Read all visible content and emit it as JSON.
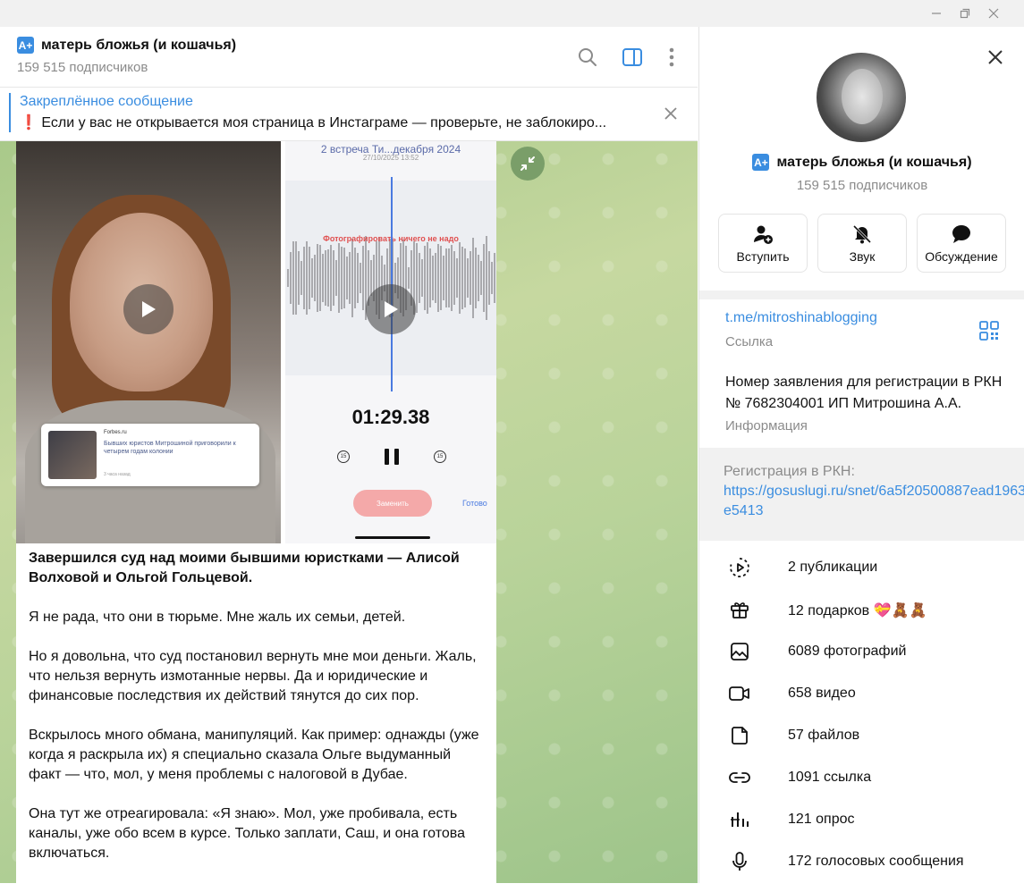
{
  "window": {
    "controls": [
      "minimize-icon",
      "restore-icon",
      "close-icon"
    ]
  },
  "header": {
    "badge": "A+",
    "title": "матерь бложья (и кошачья)",
    "subtitle": "159 515 подписчиков",
    "icons": [
      "search-icon",
      "sidebar-toggle-icon",
      "more-vertical-icon"
    ]
  },
  "pinned": {
    "title": "Закреплённое сообщение",
    "text": "❗️ Если у вас не открывается моя страница в Инстаграме — проверьте, не заблокиро..."
  },
  "message": {
    "media": {
      "left": {
        "news_source": "Forbes.ru",
        "news_headline": "Бывших юристов Митрошиной приговорили к четырем годам колонии",
        "news_time": "3 часа назад"
      },
      "right": {
        "title": "2 встреча Ти...декабря 2024",
        "date": "27/10/2025 13:52",
        "red_caption": "Фотографировать ничего не надо",
        "timer": "01:29.38",
        "skip_back": "15",
        "skip_fwd": "15",
        "pill_button": "Заменить",
        "ready": "Готово"
      }
    },
    "paragraphs": [
      "Завершился суд над моими бывшими юристками — Алисой Волховой и Ольгой Гольцевой.",
      "Я не рада, что они в тюрьме. Мне жаль их семьи, детей.",
      "Но я довольна, что суд постановил вернуть мне мои деньги. Жаль, что нельзя вернуть измотанные нервы. Да и юридические и финансовые последствия их действий тянутся до сих пор.",
      "Вскрылось много обмана, манипуляций. Как пример: однажды (уже когда я раскрыла их) я специально сказала Ольге выдуманный факт —  что, мол, у меня проблемы с налоговой в Дубае.",
      "Она тут же отреагировала: «Я знаю». Мол, уже пробивала, есть каналы, уже обо всем в курсе. Только заплати, Саш, и она готова включаться."
    ]
  },
  "profile": {
    "badge": "A+",
    "title": "матерь бложья (и кошачья)",
    "subtitle": "159 515 подписчиков",
    "actions": [
      {
        "label": "Вступить",
        "icon": "add-user-icon"
      },
      {
        "label": "Звук",
        "icon": "bell-muted-icon"
      },
      {
        "label": "Обсуждение",
        "icon": "chat-bubble-icon"
      }
    ],
    "link": "t.me/mitroshinablogging",
    "link_caption": "Ссылка",
    "info": "Номер заявления для регистрации в РКН № 7682304001 ИП Митрошина А.А.",
    "info_caption": "Информация",
    "reg_label": "Регистрация в РКН:",
    "reg_link": "https://gosuslugi.ru/snet/6a5f20500887ead1963e5413",
    "stats": [
      {
        "label": "2 публикации",
        "icon": "play-circle-icon"
      },
      {
        "label": "12 подарков",
        "icon": "gift-icon",
        "emoji": "💝🧸🧸"
      },
      {
        "label": "6089 фотографий",
        "icon": "image-icon"
      },
      {
        "label": "658 видео",
        "icon": "video-icon"
      },
      {
        "label": "57 файлов",
        "icon": "file-icon"
      },
      {
        "label": "1091 ссылка",
        "icon": "link-icon"
      },
      {
        "label": "121 опрос",
        "icon": "poll-icon"
      },
      {
        "label": "172 голосовых сообщения",
        "icon": "microphone-icon"
      }
    ]
  },
  "colors": {
    "accent": "#3a8de0",
    "muted": "#8b8b8b",
    "panel_gap": "#f1f1f1"
  }
}
